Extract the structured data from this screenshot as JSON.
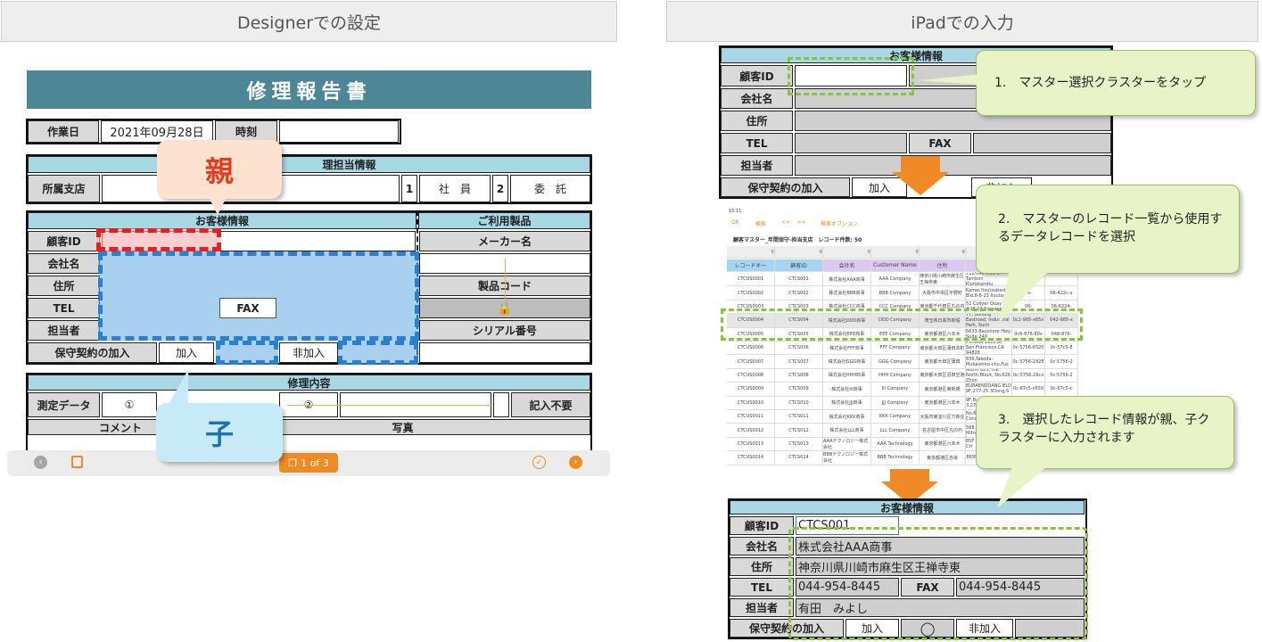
{
  "headers": {
    "left": "Designerでの設定",
    "right": "iPadでの入力"
  },
  "designer": {
    "title": "修理報告書",
    "work_date_label": "作業日",
    "work_date_value": "2021年09月28日",
    "time_label": "時刻",
    "staff_section": "理担当情報",
    "branch_label": "所属支店",
    "num1": "1",
    "employee": "社　員",
    "num2": "2",
    "consign": "委　託",
    "customer_section": "お客様情報",
    "products_section": "ご利用製品",
    "customer_id": "顧客ID",
    "maker": "メーカー名",
    "company": "会社名",
    "address": "住所",
    "product_code": "製品コード",
    "tel": "TEL",
    "fax": "FAX",
    "person": "担当者",
    "serial": "シリアル番号",
    "contract": "保守契約の加入",
    "join": "加入",
    "not_join": "非加入",
    "repair_section": "修理内容",
    "measure": "測定データ",
    "circle1": "①",
    "circle2": "②",
    "no_entry": "記入不要",
    "comment": "コメント",
    "photo": "写真",
    "parent_label": "親",
    "child_label": "子",
    "pager": "1 of 3"
  },
  "ipad_top": {
    "section": "お客様情報",
    "customer_id": "顧客ID",
    "company": "会社名",
    "address": "住所",
    "tel": "TEL",
    "fax": "FAX",
    "person": "担当者",
    "contract": "保守契約の加入",
    "join": "加入",
    "not_join": "非加入"
  },
  "ipad_list": {
    "status_time": "15:11",
    "ok": "OK",
    "search": "検索",
    "nav": "<<    >>",
    "search_opt": "検索オプション",
    "title": "顧客マスター_年間保守-担当支店　レコード件数: 50",
    "columns": [
      "レコードキー",
      "顧客ID",
      "会社名",
      "Customer Name",
      "住所",
      "Addr",
      "",
      ""
    ],
    "rows": [
      [
        "CTCUS0001",
        "CTCS001",
        "株式会社AAA商事",
        "AAA Company",
        "神奈川県川崎市麻生区王禅寺東",
        "722/845 Moo 5 Tambon Klongtamhu",
        "0cc-",
        ""
      ],
      [
        "CTCUS0002",
        "CTCS002",
        "株式会社BBB商事",
        "BBB Company",
        "大阪市中央区平野町",
        "Kamei Itsutsubashi Bld.8-6-23 Itsutsub",
        "06-",
        "06-422c-x"
      ],
      [
        "CTCUS0003",
        "CTCS003",
        "株式会社CCC商事",
        "CCC Company",
        "東京都千代田区丸の内",
        "52 Collyer Quay #28-03 Singapore",
        "06-",
        "06-6224-"
      ],
      [
        "CTCUS0004",
        "CTCS004",
        "株式会社DDD商事",
        "DDD Company",
        "埼玉県日高市新堀",
        "77, Suhong Eastroad, Industrial Park, Such",
        "0c2-965-x65x",
        "042-985-x"
      ],
      [
        "CTCUS0005",
        "CTCS005",
        "株式会社EEE商事",
        "EEE Company",
        "東京都港区六本木",
        "6633 Bayshore Hwy. Suite 240",
        "0c6-876-80x",
        "048-876-"
      ],
      [
        "CTCUS0006",
        "CTCS006",
        "株式会社FFF商事",
        "FFF Company",
        "東京都大田区蒲田本町",
        "P.O.BOX 282238 San Francisco,CA 94828",
        "0c-5756-6520",
        "0c-57c5-8"
      ],
      [
        "CTCUS0007",
        "CTCS007",
        "株式会社GGG商事",
        "GGG Company",
        "東京都大田区蒲田",
        "836,Takeda-Mukaishiro-cho,Fus",
        "0c-5756-2928",
        "0c-5756-2"
      ],
      [
        "CTCUS0008",
        "CTCS008",
        "株式会社HHH商事",
        "HHH Company",
        "東京都大田区羽田空港",
        "Room 623, the North Block, No.626 Zhon",
        "0c-5756-29cx",
        "0c-5756-2"
      ],
      [
        "CTCUS0009",
        "CTCS009",
        "株式会社III商事",
        "III Company",
        "東京都港区東新橋",
        "BURAENDDANG BLD 9F,277-25 3Dong,S",
        "0c-67c5-c659",
        "0c-67c5-c"
      ],
      [
        "CTCUS0010",
        "CTCS010",
        "株式会社JJJ商事",
        "JJJ Company",
        "東京都港区六本木",
        "9F,Burando Bldg 3,277-25 3Dong",
        "0c-5756-68",
        "0c-5756-"
      ],
      [
        "CTCUS0011",
        "CTCS011",
        "株式会社KKK商事",
        "KKK Company",
        "大阪市東淀川区下新庄",
        "No.628, Building 3, Condo 888",
        "0c-57c5-",
        "0c-57c5-"
      ],
      [
        "CTCUS0012",
        "CTCS012",
        "株式会社LLL商事",
        "LLL Company",
        "名古屋市中区丸の内",
        "588 Phaholyothin Mitraphap",
        "0c-",
        "0c-"
      ],
      [
        "CTCUS0013",
        "CTCS013",
        "AAAテクノロジー株式会社",
        "AAA Technology",
        "東京都港区六本木",
        "85F New Mansion Ctr",
        "0c-",
        "0c-"
      ],
      [
        "CTCUS0014",
        "CTCS014",
        "BBBテクノロジー株式会社",
        "BBB Technology",
        "東京都港区赤坂",
        "8899 Hills Suite 322",
        "0c-",
        "0c-"
      ]
    ]
  },
  "ipad_bottom": {
    "section": "お客様情報",
    "customer_id": "顧客ID",
    "customer_id_value": "CTCS001",
    "company": "会社名",
    "company_value": "株式会社AAA商事",
    "address": "住所",
    "address_value": "神奈川県川崎市麻生区王禅寺東",
    "tel": "TEL",
    "tel_value": "044-954-8445",
    "fax": "FAX",
    "fax_value": "044-954-8445",
    "person": "担当者",
    "person_value": "有田　みよし",
    "contract": "保守契約の加入",
    "join": "加入",
    "circle": "◯",
    "not_join": "非加入"
  },
  "callouts": {
    "step1": "1.　マスター選択クラスターをタップ",
    "step2": "2.　マスターのレコード一覧から使用するデータレコードを選択",
    "step3": "3.　選択したレコード情報が親、子クラスターに入力されます"
  },
  "colors": {
    "title_bar": "#4d8697",
    "blue_dash": "#2a7fd0",
    "red_dash": "#e52020",
    "green_dash": "#8ac43f",
    "arrow": "#f08a24"
  }
}
